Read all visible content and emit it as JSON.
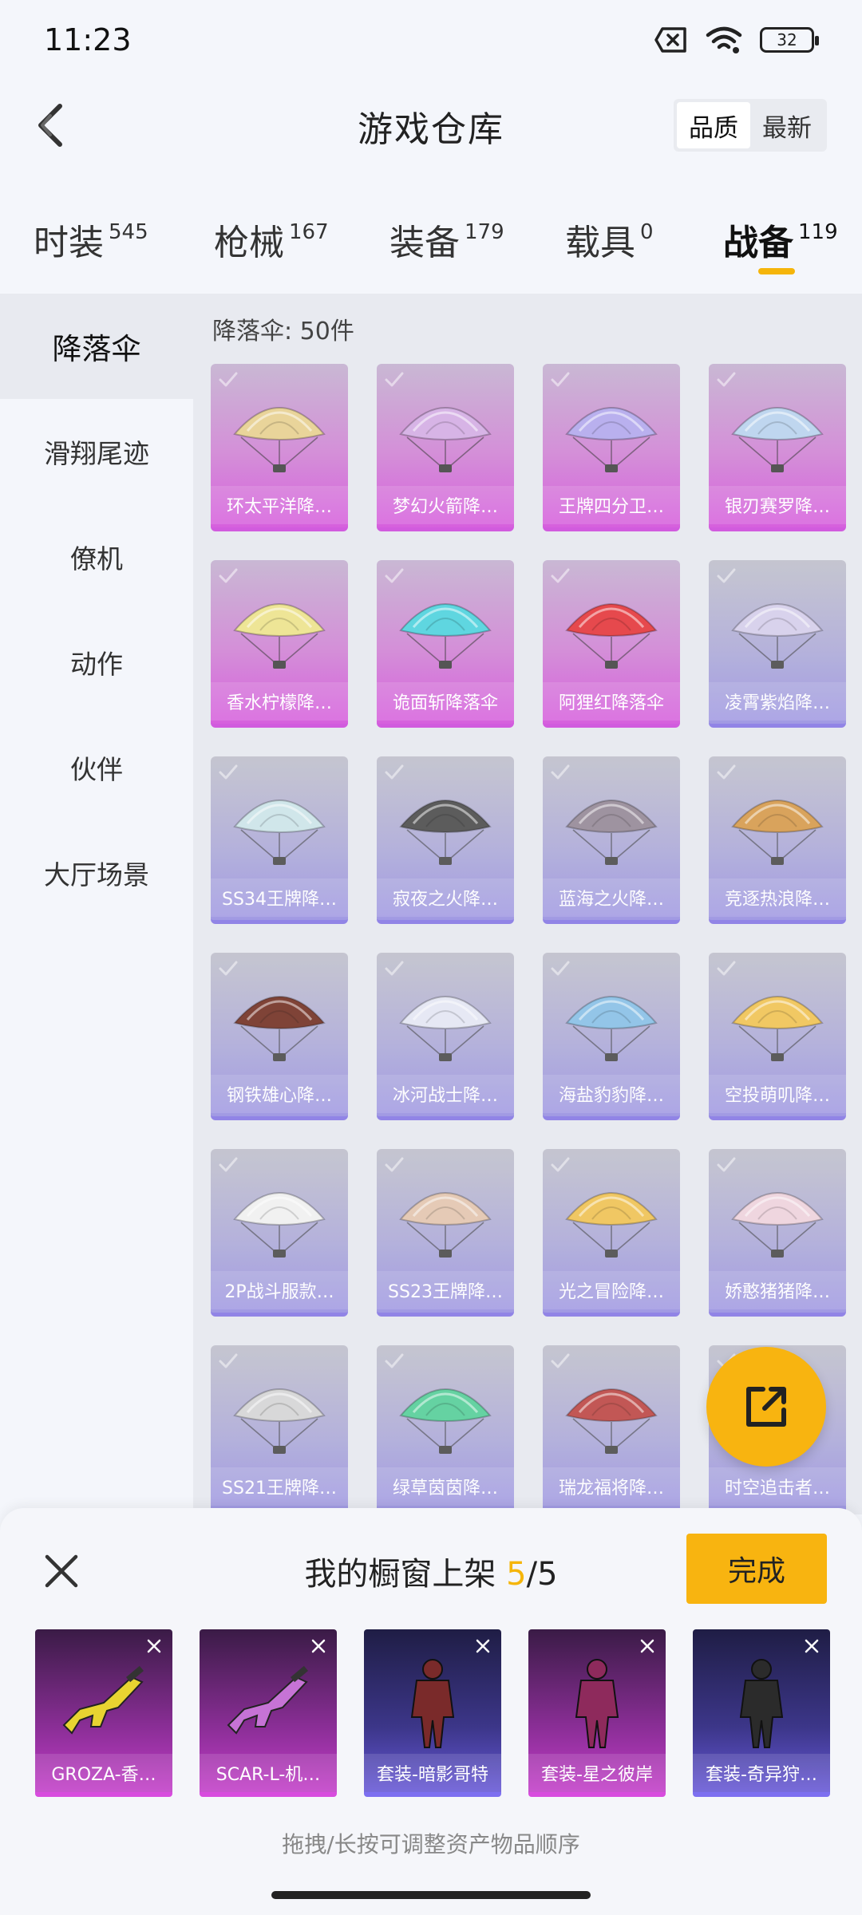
{
  "status_bar": {
    "time": "11:23",
    "battery": "32"
  },
  "header": {
    "title": "游戏仓库",
    "sort_options": [
      "品质",
      "最新"
    ],
    "sort_active": "品质"
  },
  "tabs": [
    {
      "label": "时装",
      "count": "545"
    },
    {
      "label": "枪械",
      "count": "167"
    },
    {
      "label": "装备",
      "count": "179"
    },
    {
      "label": "载具",
      "count": "0"
    },
    {
      "label": "战备",
      "count": "119",
      "active": true
    }
  ],
  "sidebar": {
    "items": [
      "降落伞",
      "滑翔尾迹",
      "僚机",
      "动作",
      "伙伴",
      "大厅场景"
    ],
    "active": "降落伞"
  },
  "section": {
    "title": "降落伞: 50件"
  },
  "items": [
    {
      "name": "环太平洋降…",
      "rarity": "pink",
      "color": "#e9d49a"
    },
    {
      "name": "梦幻火箭降…",
      "rarity": "pink",
      "color": "#d7b4e6"
    },
    {
      "name": "王牌四分卫…",
      "rarity": "pink",
      "color": "#b9b0ee"
    },
    {
      "name": "银刃赛罗降…",
      "rarity": "pink",
      "color": "#bfd6ef"
    },
    {
      "name": "香水柠檬降…",
      "rarity": "pink",
      "color": "#eee596"
    },
    {
      "name": "诡面斩降落伞",
      "rarity": "pink",
      "color": "#5fd6e0"
    },
    {
      "name": "阿狸红降落伞",
      "rarity": "pink",
      "color": "#e6494d"
    },
    {
      "name": "凌霄紫焰降…",
      "rarity": "blue",
      "color": "#d8d1ec"
    },
    {
      "name": "SS34王牌降…",
      "rarity": "blue",
      "color": "#cfe6ea"
    },
    {
      "name": "寂夜之火降…",
      "rarity": "blue",
      "color": "#555555"
    },
    {
      "name": "蓝海之火降…",
      "rarity": "blue",
      "color": "#9b8f9c"
    },
    {
      "name": "竞逐热浪降…",
      "rarity": "blue",
      "color": "#d9a055"
    },
    {
      "name": "钢铁雄心降…",
      "rarity": "blue",
      "color": "#7a3b2e"
    },
    {
      "name": "冰河战士降…",
      "rarity": "blue",
      "color": "#e6e8f5"
    },
    {
      "name": "海盐豹豹降…",
      "rarity": "blue",
      "color": "#8fc4e8"
    },
    {
      "name": "空投萌叽降…",
      "rarity": "blue",
      "color": "#f2c75c"
    },
    {
      "name": "2P战斗服款…",
      "rarity": "blue",
      "color": "#f2f2f2"
    },
    {
      "name": "SS23王牌降…",
      "rarity": "blue",
      "color": "#e5c9b3"
    },
    {
      "name": "光之冒险降…",
      "rarity": "blue",
      "color": "#f1c65c"
    },
    {
      "name": "娇憨猪猪降…",
      "rarity": "blue",
      "color": "#f0d5df"
    },
    {
      "name": "SS21王牌降…",
      "rarity": "blue",
      "color": "#d8d8d8"
    },
    {
      "name": "绿草茵茵降…",
      "rarity": "blue",
      "color": "#5ed19e"
    },
    {
      "name": "瑞龙福将降…",
      "rarity": "blue",
      "color": "#c0504d"
    },
    {
      "name": "时空追击者…",
      "rarity": "blue",
      "color": "#8a7ca8"
    }
  ],
  "showcase": {
    "title": "我的橱窗上架",
    "count_current": "5",
    "count_total": "/5",
    "done_label": "完成",
    "hint": "拖拽/长按可调整资产物品顺序",
    "items": [
      {
        "name": "GROZA-香…",
        "rarity": "pink",
        "icon": "rifle-icon",
        "color": "#e8d431"
      },
      {
        "name": "SCAR-L-机…",
        "rarity": "pink",
        "icon": "rifle-icon",
        "color": "#c673d6"
      },
      {
        "name": "套装-暗影哥特",
        "rarity": "blue",
        "icon": "outfit-icon",
        "color": "#7a2a2a"
      },
      {
        "name": "套装-星之彼岸",
        "rarity": "pink",
        "icon": "outfit-icon",
        "color": "#8e2a5c"
      },
      {
        "name": "套装-奇异狩…",
        "rarity": "blue",
        "icon": "outfit-icon",
        "color": "#2b2b2b"
      }
    ]
  },
  "colors": {
    "accent": "#f8b410",
    "rarity_pink": "#d660dd",
    "rarity_blue": "#8d7fe6"
  }
}
